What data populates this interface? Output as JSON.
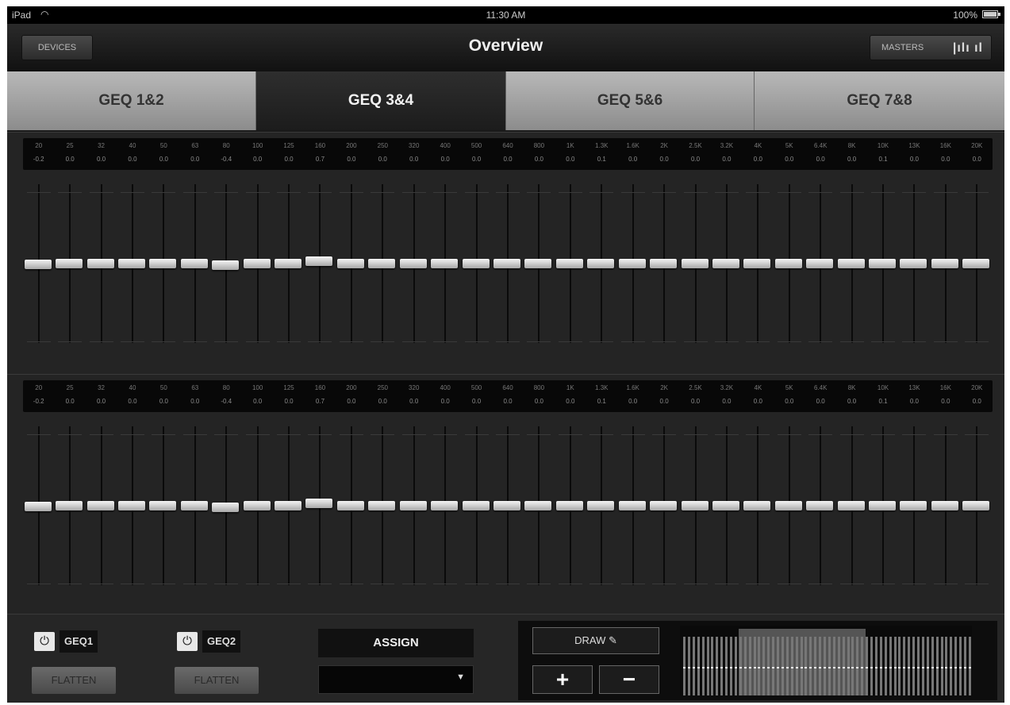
{
  "status": {
    "carrier": "iPad",
    "time": "11:30 AM",
    "battery": "100%"
  },
  "nav": {
    "title": "Overview",
    "devices_label": "DEVICES",
    "masters_label": "MASTERS",
    "masters_icon": "bar-meters-icon"
  },
  "tabs": [
    {
      "label": "GEQ 1&2",
      "active": false
    },
    {
      "label": "GEQ 3&4",
      "active": true
    },
    {
      "label": "GEQ 5&6",
      "active": false
    },
    {
      "label": "GEQ 7&8",
      "active": false
    }
  ],
  "eq1": {
    "frequencies": [
      "20",
      "25",
      "32",
      "40",
      "50",
      "63",
      "80",
      "100",
      "125",
      "160",
      "200",
      "250",
      "320",
      "400",
      "500",
      "640",
      "800",
      "1K",
      "1.3K",
      "1.6K",
      "2K",
      "2.5K",
      "3.2K",
      "4K",
      "5K",
      "6.4K",
      "8K",
      "10K",
      "13K",
      "16K",
      "20K"
    ],
    "gains": [
      "-0.2",
      "0.0",
      "0.0",
      "0.0",
      "0.0",
      "0.0",
      "-0.4",
      "0.0",
      "0.0",
      "0.7",
      "0.0",
      "0.0",
      "0.0",
      "0.0",
      "0.0",
      "0.0",
      "0.0",
      "0.0",
      "0.1",
      "0.0",
      "0.0",
      "0.0",
      "0.0",
      "0.0",
      "0.0",
      "0.0",
      "0.0",
      "0.1",
      "0.0",
      "0.0",
      "0.0"
    ]
  },
  "eq2": {
    "frequencies": [
      "20",
      "25",
      "32",
      "40",
      "50",
      "63",
      "80",
      "100",
      "125",
      "160",
      "200",
      "250",
      "320",
      "400",
      "500",
      "640",
      "800",
      "1K",
      "1.3K",
      "1.6K",
      "2K",
      "2.5K",
      "3.2K",
      "4K",
      "5K",
      "6.4K",
      "8K",
      "10K",
      "13K",
      "16K",
      "20K"
    ],
    "gains": [
      "-0.2",
      "0.0",
      "0.0",
      "0.0",
      "0.0",
      "0.0",
      "-0.4",
      "0.0",
      "0.0",
      "0.7",
      "0.0",
      "0.0",
      "0.0",
      "0.0",
      "0.0",
      "0.0",
      "0.0",
      "0.0",
      "0.1",
      "0.0",
      "0.0",
      "0.0",
      "0.0",
      "0.0",
      "0.0",
      "0.0",
      "0.0",
      "0.1",
      "0.0",
      "0.0",
      "0.0"
    ]
  },
  "bottom": {
    "geq1_label": "GEQ1",
    "geq2_label": "GEQ2",
    "flatten_label": "FLATTEN",
    "assign_label": "ASSIGN",
    "select_value": "",
    "draw_label": "DRAW",
    "plus_label": "+",
    "minus_label": "−"
  }
}
